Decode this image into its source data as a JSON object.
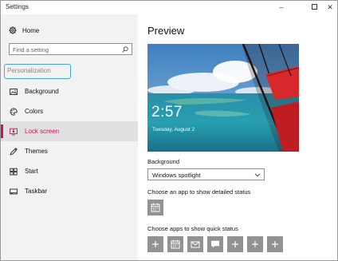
{
  "window": {
    "title": "Settings"
  },
  "sidebar": {
    "home_label": "Home",
    "search_placeholder": "Find a setting",
    "section_label": "Personalization",
    "items": [
      {
        "label": "Background",
        "icon": "background-icon",
        "active": false
      },
      {
        "label": "Colors",
        "icon": "palette-icon",
        "active": false
      },
      {
        "label": "Lock screen",
        "icon": "lock-screen-icon",
        "active": true
      },
      {
        "label": "Themes",
        "icon": "themes-icon",
        "active": false
      },
      {
        "label": "Start",
        "icon": "start-icon",
        "active": false
      },
      {
        "label": "Taskbar",
        "icon": "taskbar-icon",
        "active": false
      }
    ]
  },
  "main": {
    "title": "Preview",
    "preview": {
      "time": "2:57",
      "date": "Tuesday, August 2"
    },
    "background_label": "Background",
    "background_value": "Windows spotlight",
    "detailed_status_label": "Choose an app to show detailed status",
    "quick_status_label": "Choose apps to show quick status",
    "quick_status_icons": [
      "plus-icon",
      "calendar-icon",
      "mail-icon",
      "chat-icon",
      "plus-icon",
      "plus-icon",
      "plus-icon"
    ]
  },
  "colors": {
    "accent": "#c2185b",
    "highlight_box": "#41a8cf",
    "tile": "#929292",
    "sidebar_bg": "#f2f2f2"
  }
}
